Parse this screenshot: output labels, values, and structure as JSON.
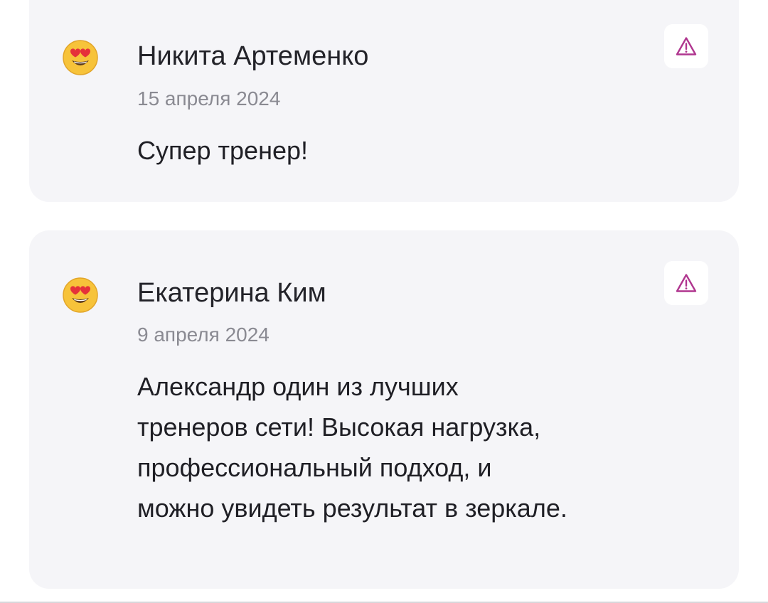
{
  "reviews": [
    {
      "avatar_icon": "smiling-face-with-heart-eyes-icon",
      "author": "Никита Артеменко",
      "date": "15 апреля 2024",
      "text": "Супер тренер!"
    },
    {
      "avatar_icon": "smiling-face-with-heart-eyes-icon",
      "author": "Екатерина Ким",
      "date": "9 апреля 2024",
      "text": "Александр один из лучших\nтренеров сети! Высокая нагрузка,\nпрофессиональный подход, и\nможно увидеть результат в зеркале."
    }
  ],
  "report_icon": "warning-triangle-icon",
  "colors": {
    "card_background": "#f5f5f8",
    "report_icon": "#b0368f",
    "author_text": "#232329",
    "date_text": "#8a8a92"
  }
}
